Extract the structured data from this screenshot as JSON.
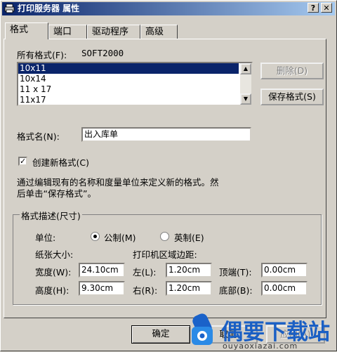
{
  "window": {
    "title": "打印服务器 属性",
    "help_label": "?",
    "close_label": "✕"
  },
  "tabs": [
    {
      "label": "格式",
      "active": true
    },
    {
      "label": "端口",
      "active": false
    },
    {
      "label": "驱动程序",
      "active": false
    },
    {
      "label": "高级",
      "active": false
    }
  ],
  "forms": {
    "all_forms_label": "所有格式(F):",
    "server_name": "SOFT2000",
    "items": [
      "10x11",
      "10x14",
      "11 x 17",
      "11x17"
    ],
    "selected_index": 0
  },
  "buttons": {
    "delete": "删除(D)",
    "save_form": "保存格式(S)",
    "ok": "确定",
    "cancel": "取消",
    "apply": "应用(A)"
  },
  "form_name": {
    "label": "格式名(N):",
    "value": "出入库单"
  },
  "create_new": {
    "label": "创建新格式(C)",
    "checked": true
  },
  "description": {
    "line1": "通过编辑现有的名称和度量单位来定义新的格式。然",
    "line2": "后单击“保存格式”。"
  },
  "measurements": {
    "group_label": "格式描述(尺寸)",
    "units_label": "单位:",
    "metric_label": "公制(M)",
    "english_label": "英制(E)",
    "paper_size_label": "纸张大小:",
    "margins_label": "打印机区域边距:",
    "width_label": "宽度(W):",
    "width_value": "24.10cm",
    "height_label": "高度(H):",
    "height_value": "9.30cm",
    "left_label": "左(L):",
    "left_value": "1.20cm",
    "right_label": "右(R):",
    "right_value": "1.20cm",
    "top_label": "顶端(T):",
    "top_value": "0.00cm",
    "bottom_label": "底部(B):",
    "bottom_value": "0.00cm"
  },
  "watermark": {
    "text": "偶要下载站",
    "url": "ouyaoxiazai.com"
  }
}
